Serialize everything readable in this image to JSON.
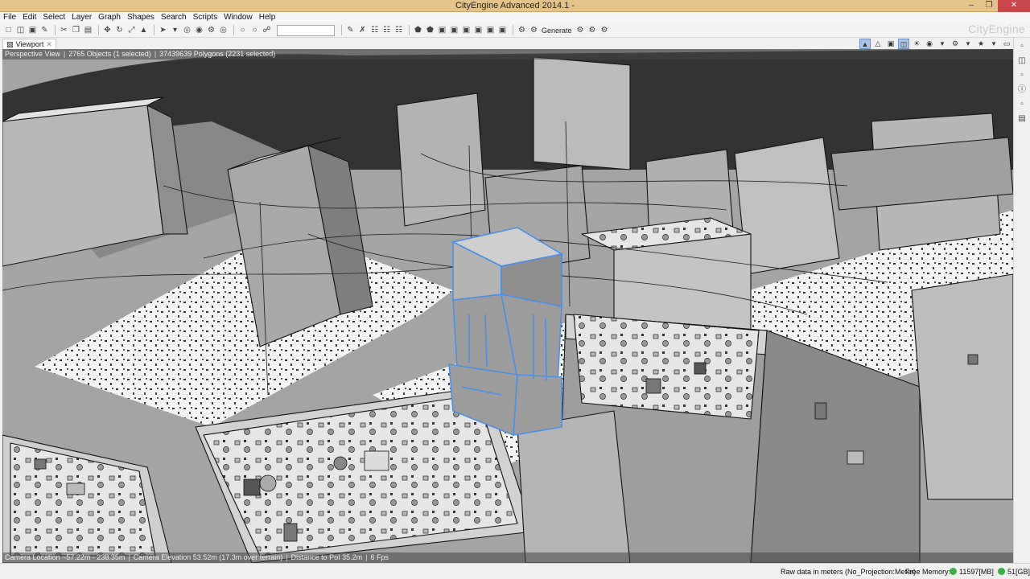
{
  "window": {
    "title": "CityEngine Advanced 2014.1 -",
    "brand": "CityEngine"
  },
  "menu": [
    "File",
    "Edit",
    "Select",
    "Layer",
    "Graph",
    "Shapes",
    "Search",
    "Scripts",
    "Window",
    "Help"
  ],
  "toolbar": {
    "generate_label": "Generate",
    "search_value": ""
  },
  "viewport": {
    "tab_label": "Viewport",
    "view_name": "Perspective View",
    "objects": "2765 Objects",
    "objects_selected": "(1 selected)",
    "polygons": "37439639 Polygons",
    "polygons_selected": "(2231 selected)",
    "camera_location": "Camera Location ~57.22m - 238.35m",
    "camera_elevation": "Camera Elevation 53.52m (17.3m over terrain)",
    "distance_to_poi": "Distance to PoI 35.2m",
    "fps": "6 Fps"
  },
  "status": {
    "projection": "Raw data in meters (No_Projection:Meter)",
    "free_memory_label": "Free Memory:",
    "memory_mb": "11597[MB]",
    "memory_gb": "51[GB]"
  },
  "colors": {
    "titlebar": "#e6c38a",
    "selection": "#4a8fe8",
    "memory_ok": "#3cb043"
  }
}
